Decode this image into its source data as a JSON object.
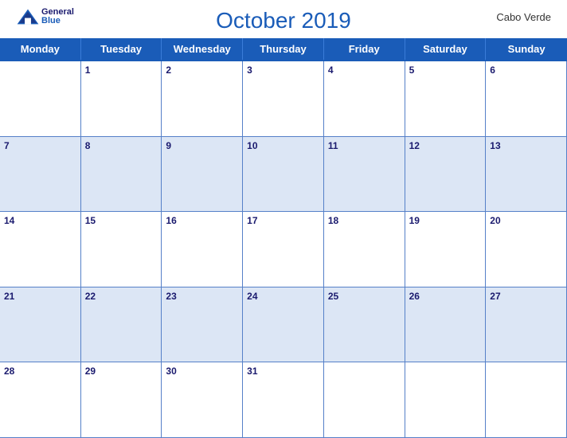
{
  "header": {
    "title": "October 2019",
    "country": "Cabo Verde",
    "logo": {
      "general": "General",
      "blue": "Blue"
    }
  },
  "days": [
    "Monday",
    "Tuesday",
    "Wednesday",
    "Thursday",
    "Friday",
    "Saturday",
    "Sunday"
  ],
  "weeks": [
    [
      null,
      1,
      2,
      3,
      4,
      5,
      6
    ],
    [
      7,
      8,
      9,
      10,
      11,
      12,
      13
    ],
    [
      14,
      15,
      16,
      17,
      18,
      19,
      20
    ],
    [
      21,
      22,
      23,
      24,
      25,
      26,
      27
    ],
    [
      28,
      29,
      30,
      31,
      null,
      null,
      null
    ]
  ],
  "accent_color": "#1a5cb8",
  "alt_row_color": "#dce6f5"
}
